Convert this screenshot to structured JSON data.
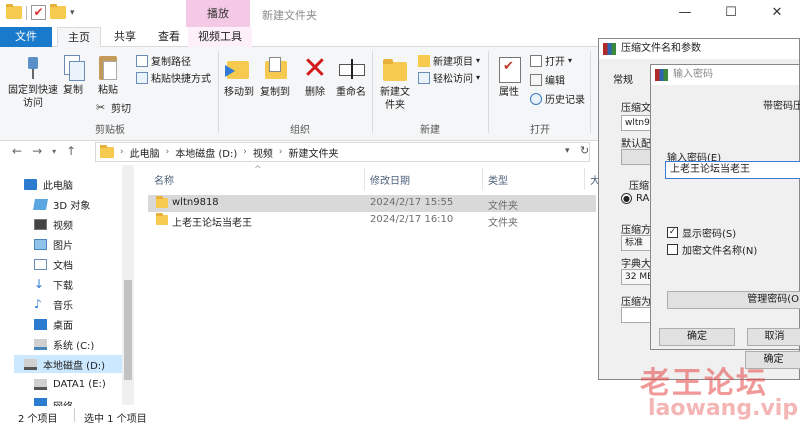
{
  "titlebar": {
    "context_tab": "播放",
    "title": "新建文件夹",
    "minimize": "—",
    "maximize": "☐",
    "close": "✕"
  },
  "tabs": [
    "文件",
    "主页",
    "共享",
    "查看",
    "视频工具"
  ],
  "ribbon": {
    "clipboard": {
      "pin": "固定到快速访问",
      "copy": "复制",
      "paste": "粘贴",
      "copy_path": "复制路径",
      "paste_shortcut": "粘贴快捷方式",
      "cut": "剪切",
      "group": "剪贴板"
    },
    "organize": {
      "move_to": "移动到",
      "copy_to": "复制到",
      "delete": "删除",
      "rename": "重命名",
      "group": "组织"
    },
    "new": {
      "new_folder": "新建文件夹",
      "new_item": "新建项目",
      "easy_access": "轻松访问",
      "group": "新建"
    },
    "open": {
      "properties": "属性",
      "open": "打开",
      "edit": "编辑",
      "history": "历史记录",
      "group": "打开"
    }
  },
  "address": {
    "crumbs": [
      "此电脑",
      "本地磁盘 (D:)",
      "视频",
      "新建文件夹"
    ]
  },
  "nav": {
    "items": [
      {
        "label": "此电脑",
        "icon": "computer-icon"
      },
      {
        "label": "3D 对象",
        "icon": "3d-objects-icon"
      },
      {
        "label": "视频",
        "icon": "video-icon"
      },
      {
        "label": "图片",
        "icon": "pictures-icon"
      },
      {
        "label": "文档",
        "icon": "documents-icon"
      },
      {
        "label": "下载",
        "icon": "download-icon"
      },
      {
        "label": "音乐",
        "icon": "music-icon"
      },
      {
        "label": "桌面",
        "icon": "desktop-icon"
      },
      {
        "label": "系统 (C:)",
        "icon": "drive-icon"
      },
      {
        "label": "本地磁盘 (D:)",
        "icon": "drive-icon"
      },
      {
        "label": "DATA1 (E:)",
        "icon": "drive-icon"
      },
      {
        "label": "网络",
        "icon": "network-icon"
      }
    ]
  },
  "list": {
    "columns": [
      "名称",
      "修改日期",
      "类型",
      "大"
    ],
    "rows": [
      {
        "name": "wltn9818",
        "date": "2024/2/17 15:55",
        "type": "文件夹"
      },
      {
        "name": "上老王论坛当老王",
        "date": "2024/2/17 16:10",
        "type": "文件夹"
      }
    ]
  },
  "status": {
    "count": "2 个项目",
    "selected": "选中 1 个项目"
  },
  "dialog_archive": {
    "title": "压缩文件名和参数",
    "tab": "常规",
    "archive_name_label": "压缩文",
    "archive_name_value": "wltn98",
    "default_label": "默认配",
    "format_label": "压缩",
    "format_option": "RA",
    "method_label": "压缩方",
    "method_value": "标准",
    "dict_label": "字典大",
    "dict_value": "32 MB",
    "split_label": "压缩为",
    "ok": "确定"
  },
  "dialog_password": {
    "title": "输入密码",
    "header": "带密码压",
    "enter_label": "输入密码(E)",
    "password_value": "上老王论坛当老王",
    "show_password": "显示密码(S)",
    "encrypt_names": "加密文件名称(N)",
    "manage": "管理密码(O",
    "ok": "确定",
    "cancel": "取消"
  },
  "watermark": {
    "cn": "老王论坛",
    "en": "laowang.vip"
  }
}
